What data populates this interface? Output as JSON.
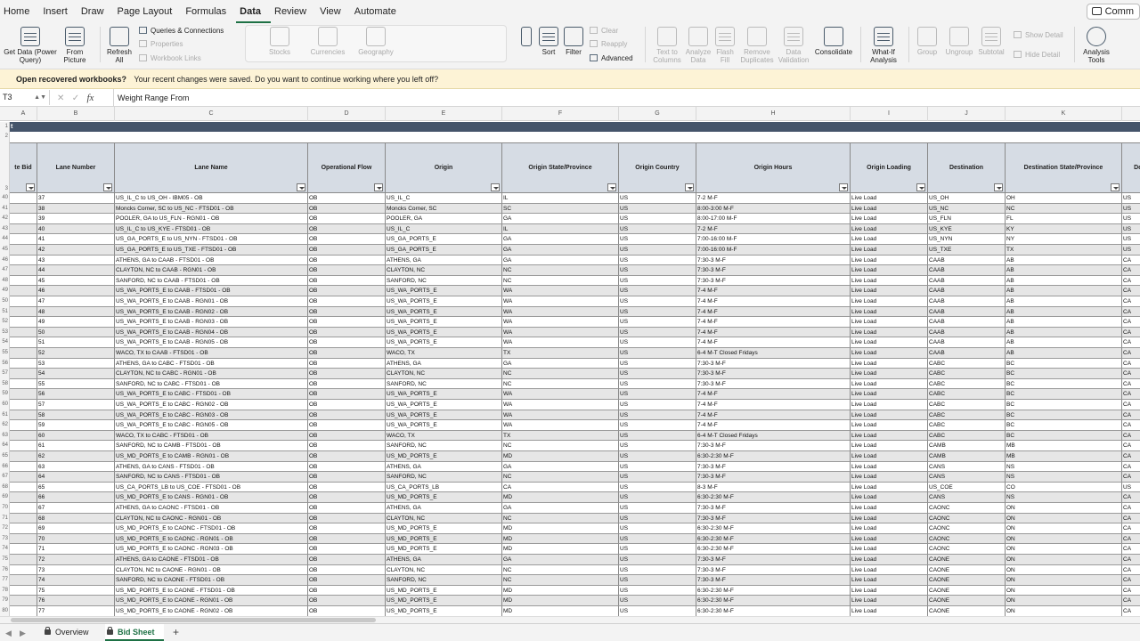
{
  "menu": {
    "tabs": [
      "Home",
      "Insert",
      "Draw",
      "Page Layout",
      "Formulas",
      "Data",
      "Review",
      "View",
      "Automate"
    ],
    "active_tab": "Data",
    "comments_label": "Comm"
  },
  "ribbon": {
    "get_data": "Get Data (Power Query)",
    "from_picture": "From Picture",
    "refresh_all": "Refresh All",
    "queries_connections": "Queries & Connections",
    "properties": "Properties",
    "workbook_links": "Workbook Links",
    "stocks": "Stocks",
    "currencies": "Currencies",
    "geography": "Geography",
    "sort": "Sort",
    "filter": "Filter",
    "clear": "Clear",
    "reapply": "Reapply",
    "advanced": "Advanced",
    "text_to_columns": "Text to Columns",
    "analyze_data": "Analyze Data",
    "flash_fill": "Flash Fill",
    "remove_duplicates": "Remove Duplicates",
    "data_validation": "Data Validation",
    "consolidate": "Consolidate",
    "what_if": "What-If Analysis",
    "group": "Group",
    "ungroup": "Ungroup",
    "subtotal": "Subtotal",
    "show_detail": "Show Detail",
    "hide_detail": "Hide Detail",
    "analysis_tools": "Analysis Tools"
  },
  "notice": {
    "title": "Open recovered workbooks?",
    "message": "Your recent changes were saved. Do you want to continue working where you left off?"
  },
  "formula_bar": {
    "name_box": "T3",
    "x_icon": "✕",
    "check_icon": "✓",
    "fx_label": "fx",
    "value": "Weight Range From"
  },
  "grid": {
    "column_letters": [
      "A",
      "B",
      "C",
      "D",
      "E",
      "F",
      "G",
      "H",
      "I",
      "J",
      "K",
      ""
    ],
    "title_band": "t",
    "header_row_numbers": [
      "1",
      "2",
      "3"
    ],
    "headers": [
      "te Bid",
      "Lane Number",
      "Lane Name",
      "Operational Flow",
      "Origin",
      "Origin State/Province",
      "Origin Country",
      "Origin Hours",
      "Origin Loading",
      "Destination",
      "Destination State/Province",
      "Des"
    ],
    "rows": [
      {
        "n": "40",
        "c": [
          "",
          "37",
          "US_IL_C to US_OH - IBM05 - OB",
          "OB",
          "US_IL_C",
          "IL",
          "US",
          "7-2 M-F",
          "Live Load",
          "US_OH",
          "OH",
          "US"
        ]
      },
      {
        "n": "41",
        "c": [
          "",
          "38",
          "Moncks Corner, SC to US_NC - FTSD01 - OB",
          "OB",
          "Moncks Corner, SC",
          "SC",
          "US",
          "8:00-3:00 M-F",
          "Live Load",
          "US_NC",
          "NC",
          "US"
        ]
      },
      {
        "n": "42",
        "c": [
          "",
          "39",
          "POOLER, GA to US_FLN - RGN01 - OB",
          "OB",
          "POOLER, GA",
          "GA",
          "US",
          "8:00-17:00 M-F",
          "Live Load",
          "US_FLN",
          "FL",
          "US"
        ]
      },
      {
        "n": "43",
        "c": [
          "",
          "40",
          "US_IL_C to US_KYE - FTSD01 - OB",
          "OB",
          "US_IL_C",
          "IL",
          "US",
          "7-2 M-F",
          "Live Load",
          "US_KYE",
          "KY",
          "US"
        ]
      },
      {
        "n": "44",
        "c": [
          "",
          "41",
          "US_GA_PORTS_E to US_NYN - FTSD01 - OB",
          "OB",
          "US_GA_PORTS_E",
          "GA",
          "US",
          "7:00-16:00 M-F",
          "Live Load",
          "US_NYN",
          "NY",
          "US"
        ]
      },
      {
        "n": "45",
        "c": [
          "",
          "42",
          "US_GA_PORTS_E to US_TXE - FTSD01 - OB",
          "OB",
          "US_GA_PORTS_E",
          "GA",
          "US",
          "7:00-16:00 M-F",
          "Live Load",
          "US_TXE",
          "TX",
          "US"
        ]
      },
      {
        "n": "46",
        "c": [
          "",
          "43",
          "ATHENS, GA to CAAB - FTSD01 - OB",
          "OB",
          "ATHENS, GA",
          "GA",
          "US",
          "7:30-3 M-F",
          "Live Load",
          "CAAB",
          "AB",
          "CA"
        ]
      },
      {
        "n": "47",
        "c": [
          "",
          "44",
          "CLAYTON, NC to CAAB - RGN01 - OB",
          "OB",
          "CLAYTON, NC",
          "NC",
          "US",
          "7:30-3 M-F",
          "Live Load",
          "CAAB",
          "AB",
          "CA"
        ]
      },
      {
        "n": "48",
        "c": [
          "",
          "45",
          "SANFORD, NC to CAAB - FTSD01 - OB",
          "OB",
          "SANFORD, NC",
          "NC",
          "US",
          "7:30-3 M-F",
          "Live Load",
          "CAAB",
          "AB",
          "CA"
        ]
      },
      {
        "n": "49",
        "c": [
          "",
          "46",
          "US_WA_PORTS_E to CAAB - FTSD01 - OB",
          "OB",
          "US_WA_PORTS_E",
          "WA",
          "US",
          "7-4 M-F",
          "Live Load",
          "CAAB",
          "AB",
          "CA"
        ]
      },
      {
        "n": "50",
        "c": [
          "",
          "47",
          "US_WA_PORTS_E to CAAB - RGN01 - OB",
          "OB",
          "US_WA_PORTS_E",
          "WA",
          "US",
          "7-4 M-F",
          "Live Load",
          "CAAB",
          "AB",
          "CA"
        ]
      },
      {
        "n": "51",
        "c": [
          "",
          "48",
          "US_WA_PORTS_E to CAAB - RGN02 - OB",
          "OB",
          "US_WA_PORTS_E",
          "WA",
          "US",
          "7-4 M-F",
          "Live Load",
          "CAAB",
          "AB",
          "CA"
        ]
      },
      {
        "n": "52",
        "c": [
          "",
          "49",
          "US_WA_PORTS_E to CAAB - RGN03 - OB",
          "OB",
          "US_WA_PORTS_E",
          "WA",
          "US",
          "7-4 M-F",
          "Live Load",
          "CAAB",
          "AB",
          "CA"
        ]
      },
      {
        "n": "53",
        "c": [
          "",
          "50",
          "US_WA_PORTS_E to CAAB - RGN04 - OB",
          "OB",
          "US_WA_PORTS_E",
          "WA",
          "US",
          "7-4 M-F",
          "Live Load",
          "CAAB",
          "AB",
          "CA"
        ]
      },
      {
        "n": "54",
        "c": [
          "",
          "51",
          "US_WA_PORTS_E to CAAB - RGN05 - OB",
          "OB",
          "US_WA_PORTS_E",
          "WA",
          "US",
          "7-4 M-F",
          "Live Load",
          "CAAB",
          "AB",
          "CA"
        ]
      },
      {
        "n": "55",
        "c": [
          "",
          "52",
          "WACO, TX to CAAB - FTSD01 - OB",
          "OB",
          "WACO, TX",
          "TX",
          "US",
          "6-4 M-T Closed Fridays",
          "Live Load",
          "CAAB",
          "AB",
          "CA"
        ]
      },
      {
        "n": "56",
        "c": [
          "",
          "53",
          "ATHENS, GA to CABC - FTSD01 - OB",
          "OB",
          "ATHENS, GA",
          "GA",
          "US",
          "7:30-3 M-F",
          "Live Load",
          "CABC",
          "BC",
          "CA"
        ]
      },
      {
        "n": "57",
        "c": [
          "",
          "54",
          "CLAYTON, NC to CABC - RGN01 - OB",
          "OB",
          "CLAYTON, NC",
          "NC",
          "US",
          "7:30-3 M-F",
          "Live Load",
          "CABC",
          "BC",
          "CA"
        ]
      },
      {
        "n": "58",
        "c": [
          "",
          "55",
          "SANFORD, NC to CABC - FTSD01 - OB",
          "OB",
          "SANFORD, NC",
          "NC",
          "US",
          "7:30-3 M-F",
          "Live Load",
          "CABC",
          "BC",
          "CA"
        ]
      },
      {
        "n": "59",
        "c": [
          "",
          "56",
          "US_WA_PORTS_E to CABC - FTSD01 - OB",
          "OB",
          "US_WA_PORTS_E",
          "WA",
          "US",
          "7-4 M-F",
          "Live Load",
          "CABC",
          "BC",
          "CA"
        ]
      },
      {
        "n": "60",
        "c": [
          "",
          "57",
          "US_WA_PORTS_E to CABC - RGN02 - OB",
          "OB",
          "US_WA_PORTS_E",
          "WA",
          "US",
          "7-4 M-F",
          "Live Load",
          "CABC",
          "BC",
          "CA"
        ]
      },
      {
        "n": "61",
        "c": [
          "",
          "58",
          "US_WA_PORTS_E to CABC - RGN03 - OB",
          "OB",
          "US_WA_PORTS_E",
          "WA",
          "US",
          "7-4 M-F",
          "Live Load",
          "CABC",
          "BC",
          "CA"
        ]
      },
      {
        "n": "62",
        "c": [
          "",
          "59",
          "US_WA_PORTS_E to CABC - RGN05 - OB",
          "OB",
          "US_WA_PORTS_E",
          "WA",
          "US",
          "7-4 M-F",
          "Live Load",
          "CABC",
          "BC",
          "CA"
        ]
      },
      {
        "n": "63",
        "c": [
          "",
          "60",
          "WACO, TX to CABC - FTSD01 - OB",
          "OB",
          "WACO, TX",
          "TX",
          "US",
          "6-4 M-T Closed Fridays",
          "Live Load",
          "CABC",
          "BC",
          "CA"
        ]
      },
      {
        "n": "64",
        "c": [
          "",
          "61",
          "SANFORD, NC to CAMB - FTSD01 - OB",
          "OB",
          "SANFORD, NC",
          "NC",
          "US",
          "7:30-3 M-F",
          "Live Load",
          "CAMB",
          "MB",
          "CA"
        ]
      },
      {
        "n": "65",
        "c": [
          "",
          "62",
          "US_MD_PORTS_E to CAMB - RGN01 - OB",
          "OB",
          "US_MD_PORTS_E",
          "MD",
          "US",
          "6:30-2:30 M-F",
          "Live Load",
          "CAMB",
          "MB",
          "CA"
        ]
      },
      {
        "n": "66",
        "c": [
          "",
          "63",
          "ATHENS, GA to CANS - FTSD01 - OB",
          "OB",
          "ATHENS, GA",
          "GA",
          "US",
          "7:30-3 M-F",
          "Live Load",
          "CANS",
          "NS",
          "CA"
        ]
      },
      {
        "n": "67",
        "c": [
          "",
          "64",
          "SANFORD, NC to CANS - FTSD01 - OB",
          "OB",
          "SANFORD, NC",
          "NC",
          "US",
          "7:30-3 M-F",
          "Live Load",
          "CANS",
          "NS",
          "CA"
        ]
      },
      {
        "n": "68",
        "c": [
          "",
          "65",
          "US_CA_PORTS_LB to US_COE - FTSD01 - OB",
          "OB",
          "US_CA_PORTS_LB",
          "CA",
          "US",
          "8-3 M-F",
          "Live Load",
          "US_COE",
          "CO",
          "US"
        ]
      },
      {
        "n": "69",
        "c": [
          "",
          "66",
          "US_MD_PORTS_E to CANS - RGN01 - OB",
          "OB",
          "US_MD_PORTS_E",
          "MD",
          "US",
          "6:30-2:30 M-F",
          "Live Load",
          "CANS",
          "NS",
          "CA"
        ]
      },
      {
        "n": "70",
        "c": [
          "",
          "67",
          "ATHENS, GA to CAONC - FTSD01 - OB",
          "OB",
          "ATHENS, GA",
          "GA",
          "US",
          "7:30-3 M-F",
          "Live Load",
          "CAONC",
          "ON",
          "CA"
        ]
      },
      {
        "n": "71",
        "c": [
          "",
          "68",
          "CLAYTON, NC to CAONC - RGN01 - OB",
          "OB",
          "CLAYTON, NC",
          "NC",
          "US",
          "7:30-3 M-F",
          "Live Load",
          "CAONC",
          "ON",
          "CA"
        ]
      },
      {
        "n": "72",
        "c": [
          "",
          "69",
          "US_MD_PORTS_E to CAONC - FTSD01 - OB",
          "OB",
          "US_MD_PORTS_E",
          "MD",
          "US",
          "6:30-2:30 M-F",
          "Live Load",
          "CAONC",
          "ON",
          "CA"
        ]
      },
      {
        "n": "73",
        "c": [
          "",
          "70",
          "US_MD_PORTS_E to CAONC - RGN01 - OB",
          "OB",
          "US_MD_PORTS_E",
          "MD",
          "US",
          "6:30-2:30 M-F",
          "Live Load",
          "CAONC",
          "ON",
          "CA"
        ]
      },
      {
        "n": "74",
        "c": [
          "",
          "71",
          "US_MD_PORTS_E to CAONC - RGN03 - OB",
          "OB",
          "US_MD_PORTS_E",
          "MD",
          "US",
          "6:30-2:30 M-F",
          "Live Load",
          "CAONC",
          "ON",
          "CA"
        ]
      },
      {
        "n": "75",
        "c": [
          "",
          "72",
          "ATHENS, GA to CAONE - FTSD01 - OB",
          "OB",
          "ATHENS, GA",
          "GA",
          "US",
          "7:30-3 M-F",
          "Live Load",
          "CAONE",
          "ON",
          "CA"
        ]
      },
      {
        "n": "76",
        "c": [
          "",
          "73",
          "CLAYTON, NC to CAONE - RGN01 - OB",
          "OB",
          "CLAYTON, NC",
          "NC",
          "US",
          "7:30-3 M-F",
          "Live Load",
          "CAONE",
          "ON",
          "CA"
        ]
      },
      {
        "n": "77",
        "c": [
          "",
          "74",
          "SANFORD, NC to CAONE - FTSD01 - OB",
          "OB",
          "SANFORD, NC",
          "NC",
          "US",
          "7:30-3 M-F",
          "Live Load",
          "CAONE",
          "ON",
          "CA"
        ]
      },
      {
        "n": "78",
        "c": [
          "",
          "75",
          "US_MD_PORTS_E to CAONE - FTSD01 - OB",
          "OB",
          "US_MD_PORTS_E",
          "MD",
          "US",
          "6:30-2:30 M-F",
          "Live Load",
          "CAONE",
          "ON",
          "CA"
        ]
      },
      {
        "n": "79",
        "c": [
          "",
          "76",
          "US_MD_PORTS_E to CAONE - RGN01 - OB",
          "OB",
          "US_MD_PORTS_E",
          "MD",
          "US",
          "6:30-2:30 M-F",
          "Live Load",
          "CAONE",
          "ON",
          "CA"
        ]
      },
      {
        "n": "80",
        "c": [
          "",
          "77",
          "US_MD_PORTS_E to CAONE - RGN02 - OB",
          "OB",
          "US_MD_PORTS_E",
          "MD",
          "US",
          "6:30-2:30 M-F",
          "Live Load",
          "CAONE",
          "ON",
          "CA"
        ]
      }
    ]
  },
  "sheets": {
    "prev_arrow": "◀",
    "next_arrow": "▶",
    "tabs": [
      "Overview",
      "Bid Sheet"
    ],
    "active": "Bid Sheet",
    "add_label": "+"
  },
  "colors": {
    "title_band": "#44546a",
    "header_fill": "#d6dce4",
    "alt_row": "#e6e6e6",
    "accent": "#1e7145",
    "notice_bg": "#fdf3d6"
  }
}
